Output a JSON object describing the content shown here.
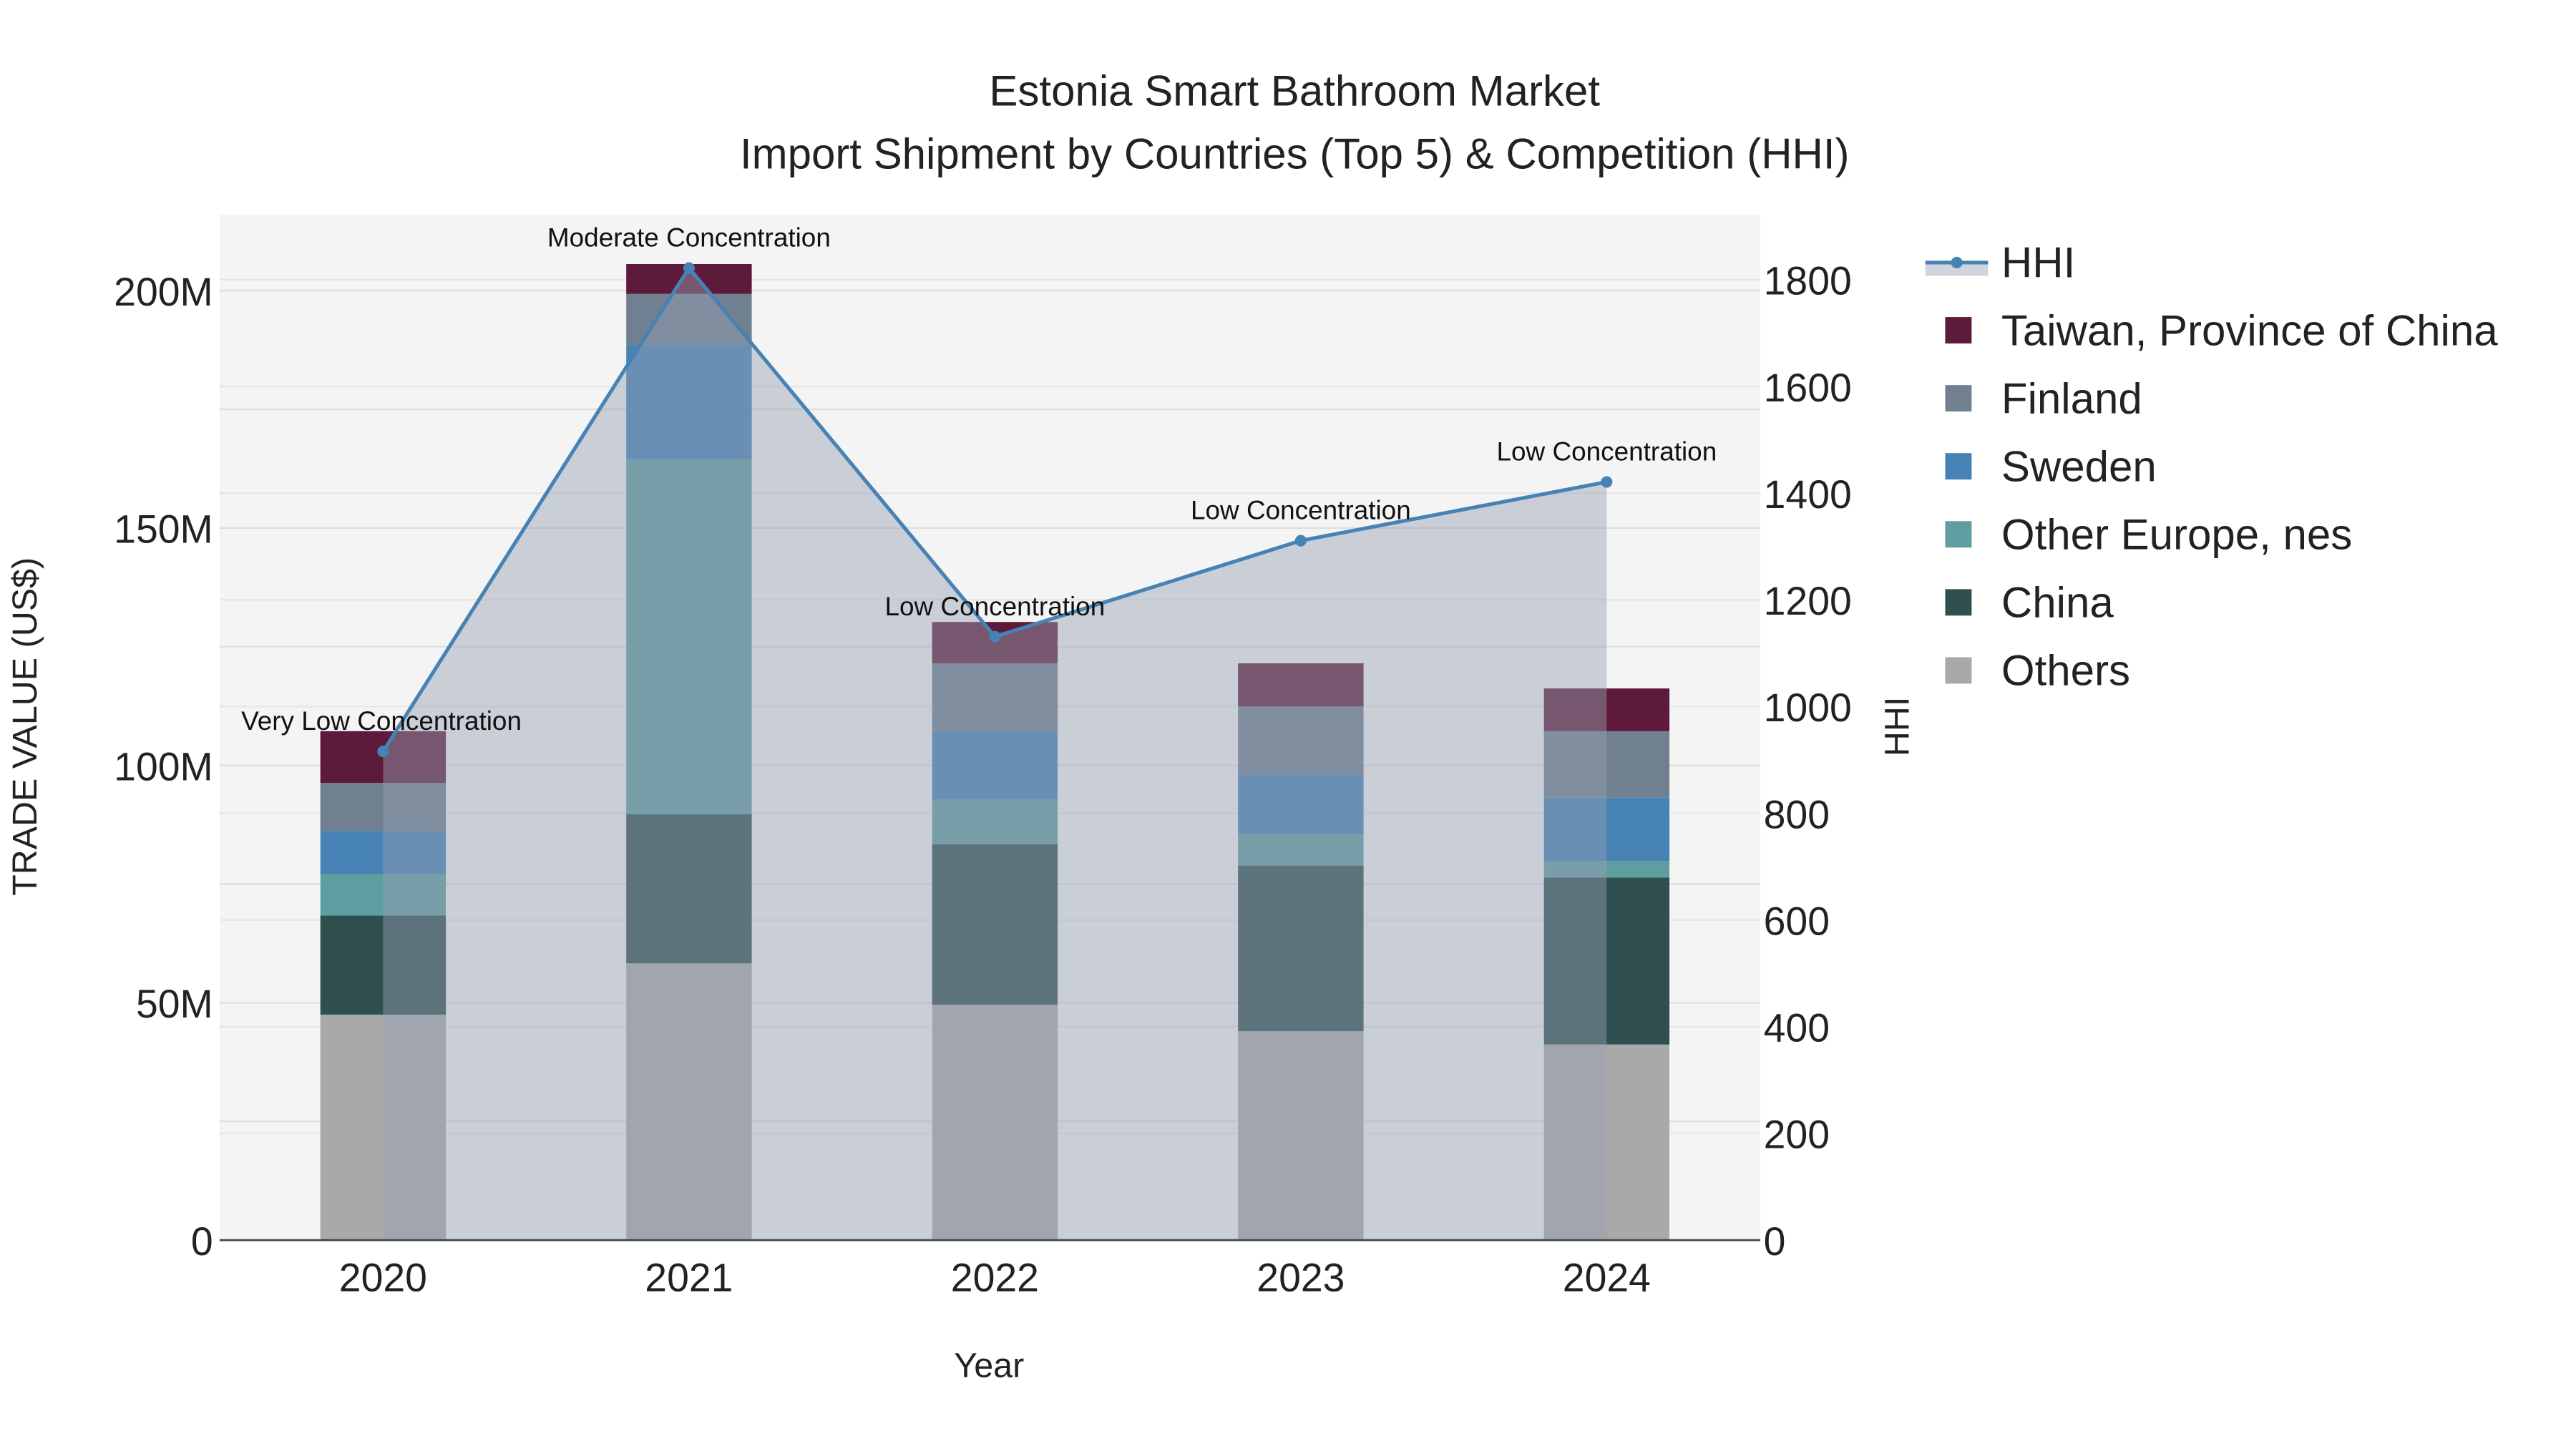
{
  "chart_data": {
    "type": "bar",
    "title": "Estonia Smart Bathroom Market",
    "subtitle": "Import Shipment by Countries (Top 5) & Competition (HHI)",
    "xlabel": "Year",
    "ylabel": "TRADE VALUE (US$)",
    "y2label": "HHI",
    "categories": [
      "2020",
      "2021",
      "2022",
      "2023",
      "2024"
    ],
    "ylim": [
      0,
      216000000
    ],
    "y2lim": [
      0,
      1922
    ],
    "yticks": [
      {
        "v": 0,
        "label": "0"
      },
      {
        "v": 50000000,
        "label": "50M"
      },
      {
        "v": 100000000,
        "label": "100M"
      },
      {
        "v": 150000000,
        "label": "150M"
      },
      {
        "v": 200000000,
        "label": "200M"
      }
    ],
    "y2ticks": [
      0,
      200,
      400,
      600,
      800,
      1000,
      1200,
      1400,
      1600,
      1800
    ],
    "grid": true,
    "legend_position": "right",
    "series": [
      {
        "name": "Others",
        "color": "#a9a9a9",
        "values": [
          47500000,
          58300000,
          49600000,
          44000000,
          41200000
        ]
      },
      {
        "name": "China",
        "color": "#2f4f4f",
        "values": [
          20900000,
          31400000,
          33800000,
          34900000,
          35200000
        ]
      },
      {
        "name": "Other Europe, nes",
        "color": "#5f9ea0",
        "values": [
          8700000,
          74700000,
          9400000,
          6600000,
          3500000
        ]
      },
      {
        "name": "Sweden",
        "color": "#4682b4",
        "values": [
          9100000,
          24100000,
          14400000,
          12600000,
          13300000
        ]
      },
      {
        "name": "Finland",
        "color": "#708090",
        "values": [
          10100000,
          10800000,
          14300000,
          14300000,
          14000000
        ]
      },
      {
        "name": "Taiwan, Province of China",
        "color": "#5e1a3a",
        "values": [
          10900000,
          6300000,
          8700000,
          9100000,
          9000000
        ]
      }
    ],
    "hhi": {
      "name": "HHI",
      "color": "#4682b4",
      "values": [
        916,
        1822,
        1131,
        1311,
        1421
      ],
      "annotations": [
        "Very Low Concentration",
        "Moderate Concentration",
        "Low Concentration",
        "Low Concentration",
        "Low Concentration"
      ]
    },
    "legend_order": [
      "HHI",
      "Taiwan, Province of China",
      "Finland",
      "Sweden",
      "Other Europe, nes",
      "China",
      "Others"
    ]
  }
}
